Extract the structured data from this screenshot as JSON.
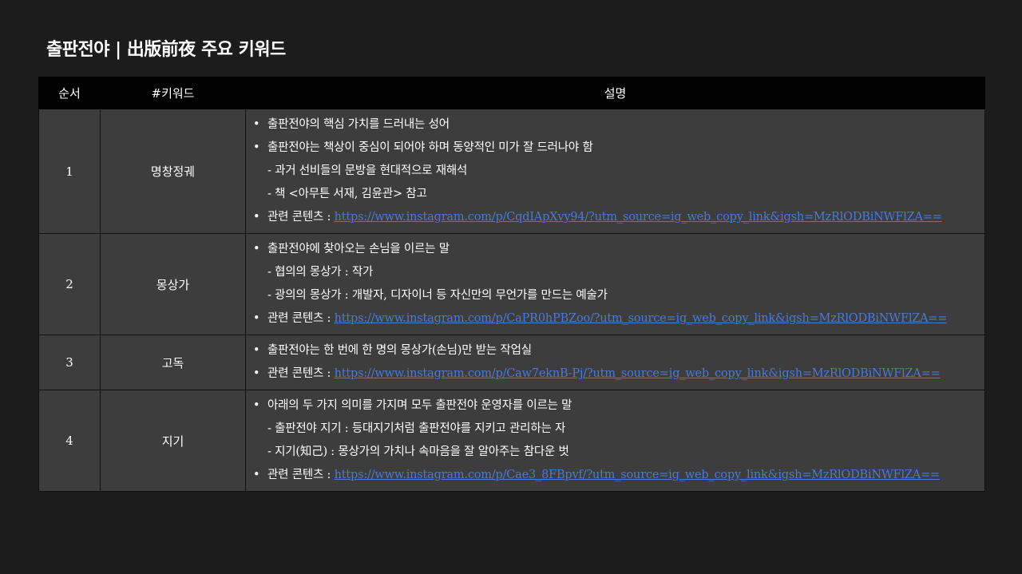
{
  "title": "출판전야 | 出版前夜 주요 키워드",
  "headers": {
    "order": "순서",
    "keyword": "#키워드",
    "description": "설명"
  },
  "rows": [
    {
      "num": "1",
      "keyword": "명창정궤",
      "lines": [
        {
          "type": "bullet",
          "text": "출판전야의 핵심 가치를 드러내는 성어"
        },
        {
          "type": "bullet",
          "text": "출판전야는 책상이 중심이 되어야 하며 동양적인 미가 잘 드러나야 함"
        },
        {
          "type": "sub",
          "text": "- 과거 선비들의 문방을 현대적으로 재해석"
        },
        {
          "type": "sub",
          "text": "- 책 <아무튼 서재, 김윤관> 참고"
        },
        {
          "type": "link",
          "label": "관련 콘텐츠 : ",
          "url": "https://www.instagram.com/p/CqdIApXvy94/?utm_source=ig_web_copy_link&igsh=MzRlODBiNWFlZA=="
        }
      ]
    },
    {
      "num": "2",
      "keyword": "몽상가",
      "lines": [
        {
          "type": "bullet",
          "text": "출판전야에 찾아오는 손님을 이르는 말"
        },
        {
          "type": "sub",
          "text": "- 협의의 몽상가 : 작가"
        },
        {
          "type": "sub",
          "text": "- 광의의 몽상가 : 개발자, 디자이너 등 자신만의 무언가를 만드는 예술가"
        },
        {
          "type": "link",
          "label": "관련 콘텐츠 : ",
          "url": "https://www.instagram.com/p/CaPR0hPBZoo/?utm_source=ig_web_copy_link&igsh=MzRlODBiNWFlZA=="
        }
      ]
    },
    {
      "num": "3",
      "keyword": "고독",
      "lines": [
        {
          "type": "bullet",
          "text": "출판전야는 한 번에 한 명의 몽상가(손님)만 받는 작업실"
        },
        {
          "type": "link",
          "label": "관련 콘텐츠 : ",
          "url": "https://www.instagram.com/p/Caw7eknB-Pj/?utm_source=ig_web_copy_link&igsh=MzRlODBiNWFlZA=="
        }
      ]
    },
    {
      "num": "4",
      "keyword": "지기",
      "lines": [
        {
          "type": "bullet",
          "text": "아래의 두 가지 의미를 가지며 모두 출판전야 운영자를 이르는 말"
        },
        {
          "type": "sub",
          "text": "- 출판전야 지기 : 등대지기처럼 출판전야를 지키고 관리하는 자"
        },
        {
          "type": "sub",
          "text": "- 지기(知己) : 몽상가의 가치나 속마음을 잘 알아주는 참다운 벗"
        },
        {
          "type": "link",
          "label": "관련 콘텐츠 : ",
          "url": "https://www.instagram.com/p/Cae3_8FBpvf/?utm_source=ig_web_copy_link&igsh=MzRlODBiNWFlZA=="
        }
      ]
    }
  ]
}
